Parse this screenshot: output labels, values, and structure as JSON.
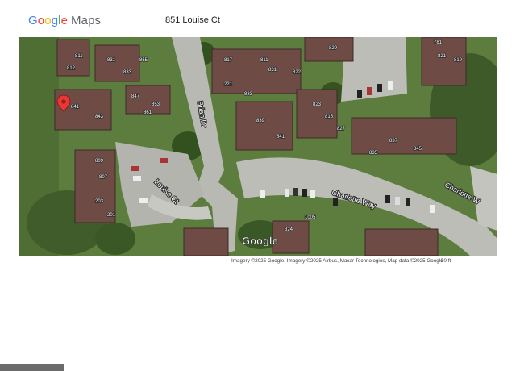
{
  "header": {
    "logo": {
      "g1": "G",
      "g2": "o",
      "g3": "o",
      "g4": "g",
      "g5": "l",
      "g6": "e",
      "maps": "Maps"
    },
    "address": "851 Louise Ct"
  },
  "map": {
    "street_labels": [
      "Brian Dr",
      "Louise Ct",
      "Charlotte Way",
      "Charlotte W"
    ],
    "unit_labels": [
      "811",
      "812",
      "831",
      "833",
      "855",
      "841",
      "843",
      "847",
      "853",
      "861",
      "809",
      "807",
      "817",
      "811",
      "221",
      "831",
      "822",
      "833",
      "839",
      "841",
      "829",
      "781",
      "821",
      "819",
      "823",
      "815",
      "827",
      "835",
      "837",
      "845",
      "203",
      "201",
      "1005",
      "824"
    ],
    "watermark": "Google",
    "marker": "red-location-pin"
  },
  "footer": {
    "attribution": "Imagery ©2025 Google, Imagery ©2025 Airbus, Maxar Technologies, Map data ©2025 Google",
    "scale": "50 ft"
  }
}
